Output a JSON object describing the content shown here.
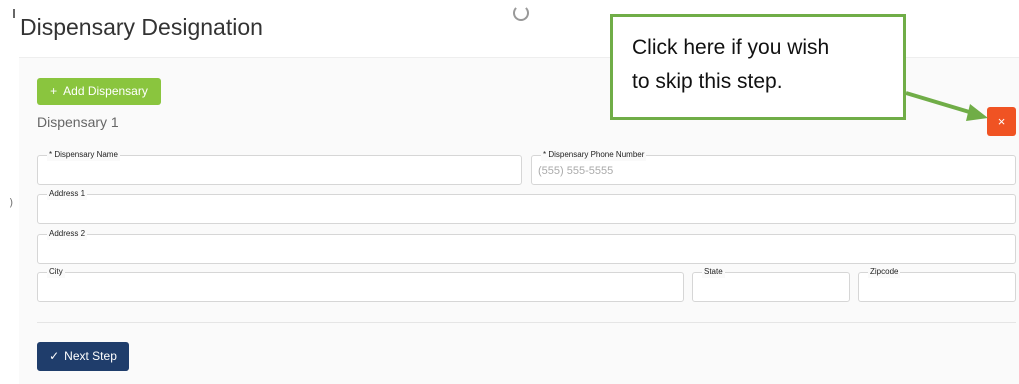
{
  "page": {
    "title": "Dispensary Designation"
  },
  "toolbar": {
    "add_label": "Add Dispensary",
    "add_icon": "plus-icon"
  },
  "section": {
    "label": "Dispensary 1"
  },
  "close_button": {
    "label": "×",
    "icon": "close-icon",
    "color": "#f05323"
  },
  "fields": {
    "name": {
      "label": "* Dispensary Name",
      "value": "",
      "placeholder": ""
    },
    "phone": {
      "label": "* Dispensary Phone Number",
      "value": "",
      "placeholder": "(555) 555-5555"
    },
    "address1": {
      "label": "Address 1",
      "value": "",
      "placeholder": ""
    },
    "address2": {
      "label": "Address 2",
      "value": "",
      "placeholder": ""
    },
    "city": {
      "label": "City",
      "value": "",
      "placeholder": ""
    },
    "state": {
      "label": "State",
      "value": "",
      "placeholder": ""
    },
    "zipcode": {
      "label": "Zipcode",
      "value": "",
      "placeholder": ""
    }
  },
  "footer": {
    "next_label": "Next Step",
    "next_icon": "checkmark-icon",
    "color": "#1f3d6b"
  },
  "callout": {
    "line1": "Click here if you wish",
    "line2": "to skip this step.",
    "border_color": "#70ad47"
  },
  "colors": {
    "add_button": "#8ac53e"
  }
}
